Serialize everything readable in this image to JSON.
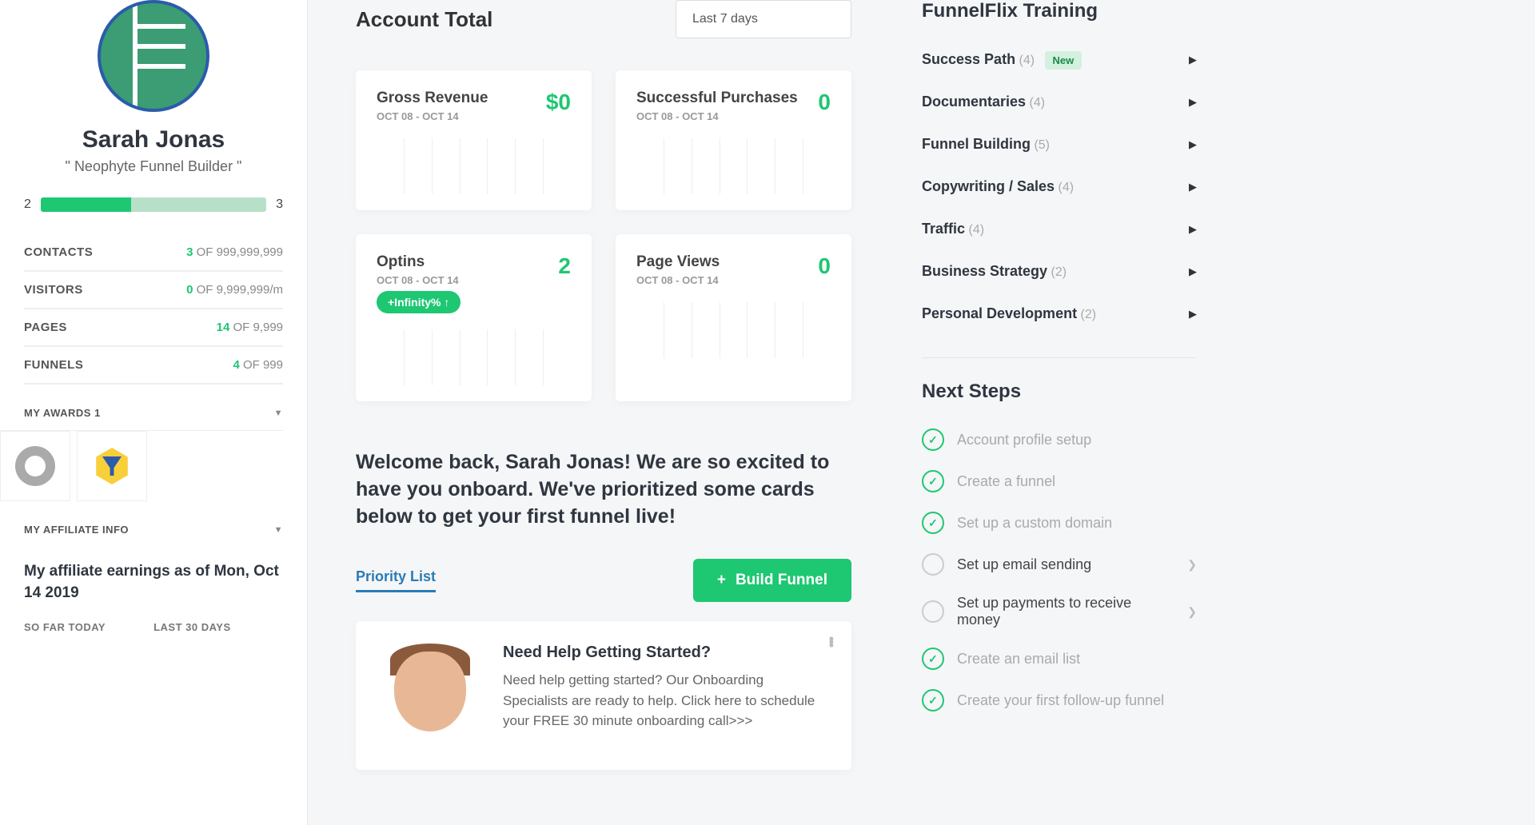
{
  "profile": {
    "name": "Sarah Jonas",
    "title": "\" Neophyte Funnel Builder \"",
    "level_from": "2",
    "level_to": "3"
  },
  "stats": [
    {
      "label": "CONTACTS",
      "value": "3",
      "of": "OF",
      "max": "999,999,999"
    },
    {
      "label": "VISITORS",
      "value": "0",
      "of": "OF",
      "max": "9,999,999/m"
    },
    {
      "label": "PAGES",
      "value": "14",
      "of": "OF",
      "max": "9,999"
    },
    {
      "label": "FUNNELS",
      "value": "4",
      "of": "OF",
      "max": "999"
    }
  ],
  "awards_title": "MY AWARDS 1",
  "affiliate": {
    "section_title": "MY AFFILIATE INFO",
    "heading": "My affiliate earnings as of Mon, Oct 14 2019",
    "col1": "SO FAR TODAY",
    "col2": "LAST 30 DAYS"
  },
  "main": {
    "title": "Account Total",
    "range": "Last 7 days"
  },
  "cards": [
    {
      "label": "Gross Revenue",
      "value": "$0",
      "date": "OCT 08 - OCT 14"
    },
    {
      "label": "Successful Purchases",
      "value": "0",
      "date": "OCT 08 - OCT 14"
    },
    {
      "label": "Optins",
      "value": "2",
      "date": "OCT 08 - OCT 14",
      "badge": "+Infinity% ↑"
    },
    {
      "label": "Page Views",
      "value": "0",
      "date": "OCT 08 - OCT 14"
    }
  ],
  "welcome": "Welcome back, Sarah Jonas! We are so excited to have you onboard. We've prioritized some cards below to get your first funnel live!",
  "tab": "Priority List",
  "build_label": "Build Funnel",
  "help": {
    "title": "Need Help Getting Started?",
    "body": "Need help getting started? Our Onboarding Specialists are ready to help. Click here to schedule your FREE 30 minute onboarding call>>>"
  },
  "training": {
    "title": "FunnelFlix Training",
    "items": [
      {
        "label": "Success Path",
        "count": "(4)",
        "new": "New"
      },
      {
        "label": "Documentaries",
        "count": "(4)"
      },
      {
        "label": "Funnel Building",
        "count": "(5)"
      },
      {
        "label": "Copywriting / Sales",
        "count": "(4)"
      },
      {
        "label": "Traffic",
        "count": "(4)"
      },
      {
        "label": "Business Strategy",
        "count": "(2)"
      },
      {
        "label": "Personal Development",
        "count": "(2)"
      }
    ]
  },
  "next_steps": {
    "title": "Next Steps",
    "items": [
      {
        "label": "Account profile setup",
        "done": true
      },
      {
        "label": "Create a funnel",
        "done": true
      },
      {
        "label": "Set up a custom domain",
        "done": true
      },
      {
        "label": "Set up email sending",
        "done": false,
        "arrow": true
      },
      {
        "label": "Set up payments to receive money",
        "done": false,
        "arrow": true
      },
      {
        "label": "Create an email list",
        "done": true
      },
      {
        "label": "Create your first follow-up funnel",
        "done": true
      }
    ]
  }
}
